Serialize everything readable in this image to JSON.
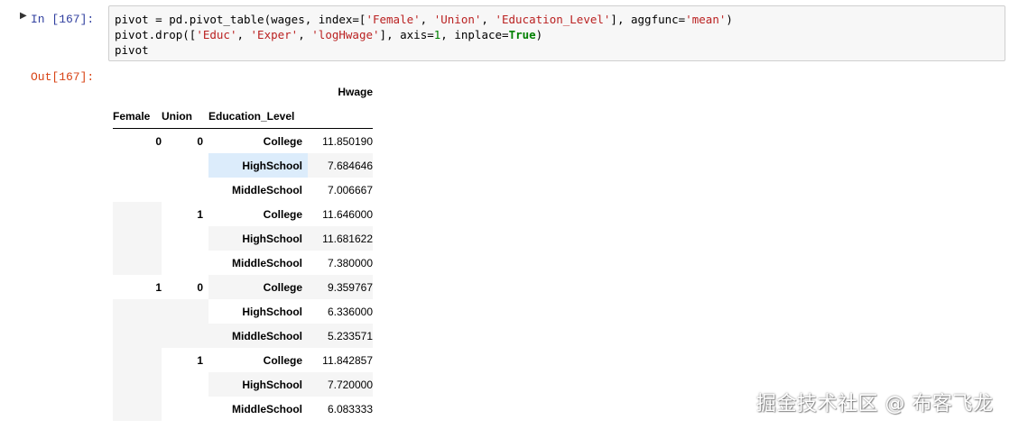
{
  "cell": {
    "marker": "▶",
    "in_prompt": "In [167]:",
    "out_prompt": "Out[167]:"
  },
  "code": {
    "line1": {
      "a": "pivot = pd.pivot_table(wages, index=[",
      "s1": "'Female'",
      "b": ", ",
      "s2": "'Union'",
      "c": ", ",
      "s3": "'Education_Level'",
      "d": "], aggfunc=",
      "s4": "'mean'",
      "e": ")"
    },
    "line2": {
      "a": "pivot.drop([",
      "s1": "'Educ'",
      "b": ", ",
      "s2": "'Exper'",
      "c": ", ",
      "s3": "'logHwage'",
      "d": "], axis=",
      "n1": "1",
      "e": ", inplace=",
      "k1": "True",
      "f": ")"
    },
    "line3": "pivot"
  },
  "table": {
    "value_column": "Hwage",
    "index_names": [
      "Female",
      "Union",
      "Education_Level"
    ],
    "rows": [
      {
        "female": "0",
        "union": "0",
        "education": "College",
        "hwage": "11.850190"
      },
      {
        "female": "",
        "union": "",
        "education": "HighSchool",
        "hwage": "7.684646"
      },
      {
        "female": "",
        "union": "",
        "education": "MiddleSchool",
        "hwage": "7.006667"
      },
      {
        "female": "",
        "union": "1",
        "education": "College",
        "hwage": "11.646000"
      },
      {
        "female": "",
        "union": "",
        "education": "HighSchool",
        "hwage": "11.681622"
      },
      {
        "female": "",
        "union": "",
        "education": "MiddleSchool",
        "hwage": "7.380000"
      },
      {
        "female": "1",
        "union": "0",
        "education": "College",
        "hwage": "9.359767"
      },
      {
        "female": "",
        "union": "",
        "education": "HighSchool",
        "hwage": "6.336000"
      },
      {
        "female": "",
        "union": "",
        "education": "MiddleSchool",
        "hwage": "5.233571"
      },
      {
        "female": "",
        "union": "1",
        "education": "College",
        "hwage": "11.842857"
      },
      {
        "female": "",
        "union": "",
        "education": "HighSchool",
        "hwage": "7.720000"
      },
      {
        "female": "",
        "union": "",
        "education": "MiddleSchool",
        "hwage": "6.083333"
      }
    ]
  },
  "watermark": "掘金技术社区 @ 布客飞龙",
  "colors": {
    "in_prompt": "#303f9f",
    "out_prompt": "#d84315",
    "string": "#ba2121",
    "keyword": "#008000",
    "row_stripe": "#f5f5f5",
    "row_highlight": "#dcecfb"
  }
}
